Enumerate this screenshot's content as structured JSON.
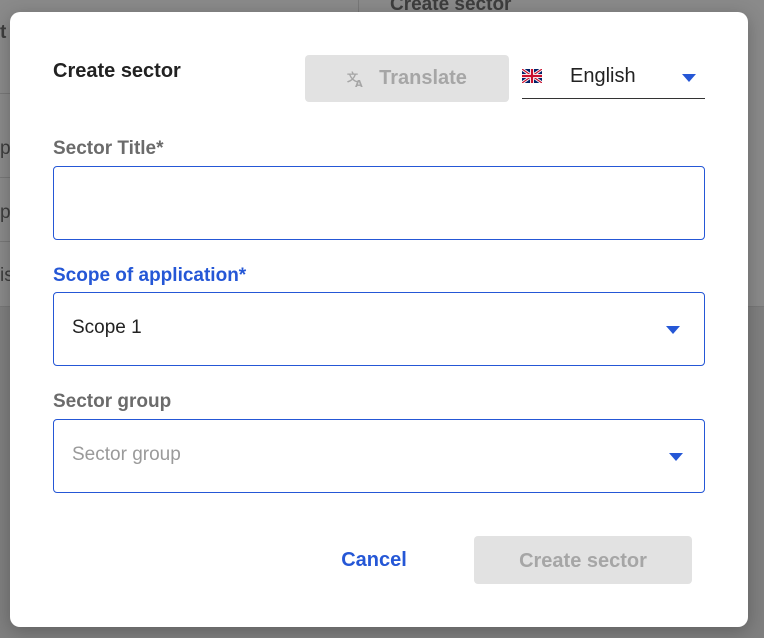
{
  "background": {
    "header_text": "Create sector",
    "side_letters": [
      "t",
      "p",
      "p",
      "is"
    ]
  },
  "modal": {
    "title": "Create sector",
    "translate_label": "Translate",
    "language": {
      "selected": "English",
      "flag_icon": "uk-flag-icon"
    },
    "fields": {
      "sector_title": {
        "label": "Sector Title*",
        "value": ""
      },
      "scope": {
        "label": "Scope of application*",
        "value": "Scope 1"
      },
      "sector_group": {
        "label": "Sector group",
        "placeholder": "Sector group",
        "value": ""
      }
    },
    "buttons": {
      "cancel": "Cancel",
      "create": "Create sector"
    }
  },
  "colors": {
    "accent": "#2557d6",
    "disabled_bg": "#e2e2e2",
    "disabled_text": "#a6a6a6",
    "overlay": "#7f7f7f"
  }
}
